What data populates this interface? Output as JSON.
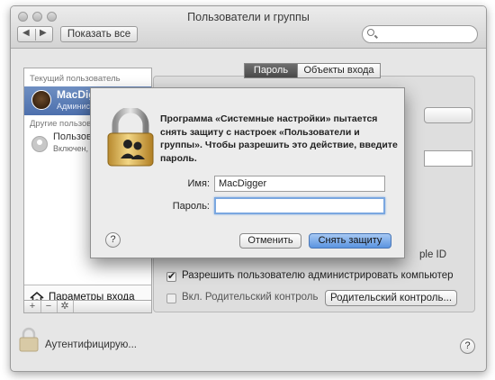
{
  "window": {
    "title": "Пользователи и группы"
  },
  "toolbar": {
    "show_all": "Показать все",
    "search_placeholder": ""
  },
  "sidebar": {
    "current_header": "Текущий пользователь",
    "current_user": {
      "name": "MacDigger",
      "role": "Администратор"
    },
    "other_header": "Другие пользователи",
    "other_user": {
      "name": "Пользователь",
      "status": "Включен, Гость"
    },
    "login_options": "Параметры входа"
  },
  "tabs": [
    "Пароль",
    "Объекты входа"
  ],
  "pane": {
    "apple_id_fragment": "ple ID",
    "allow_admin": "Разрешить пользователю администрировать компьютер",
    "parental_checkbox": "Вкл. Родительский контроль",
    "parental_button": "Родительский контроль..."
  },
  "footer": {
    "status": "Аутентифицирую..."
  },
  "dialog": {
    "message": "Программа «Системные настройки» пытается снять защиту с настроек «Пользователи и группы». Чтобы разрешить это действие, введите пароль.",
    "name_label": "Имя:",
    "name_value": "MacDigger",
    "password_label": "Пароль:",
    "password_value": "",
    "cancel": "Отменить",
    "unlock": "Снять защиту"
  },
  "colors": {
    "accent": "#4d70ad",
    "default_button": "#5b94e0"
  }
}
